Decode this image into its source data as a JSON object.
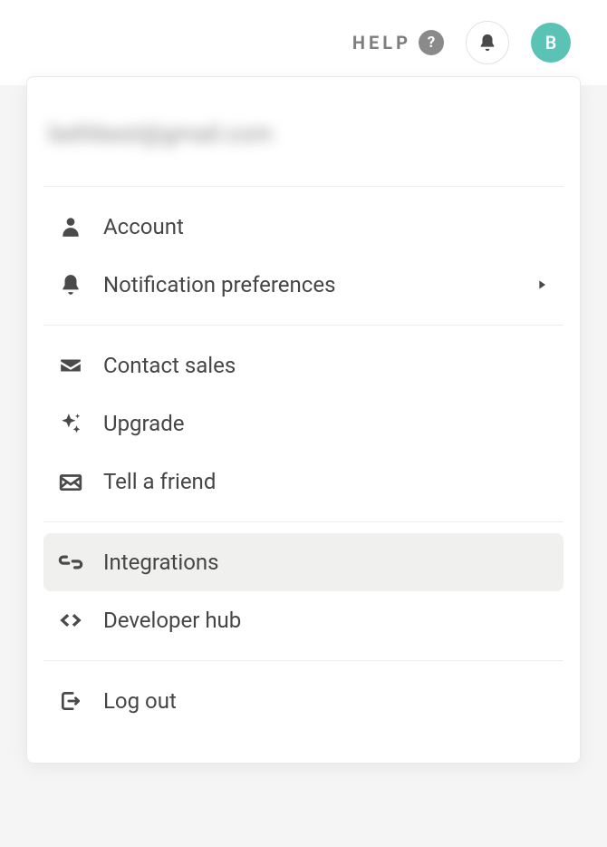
{
  "topbar": {
    "help_label": "HELP",
    "avatar_initial": "B"
  },
  "dropdown": {
    "email": "bethbest@gmail.com",
    "sections": [
      {
        "items": [
          {
            "label": "Account",
            "icon": "user",
            "has_submenu": false,
            "selected": false
          },
          {
            "label": "Notification preferences",
            "icon": "bell",
            "has_submenu": true,
            "selected": false
          }
        ]
      },
      {
        "items": [
          {
            "label": "Contact sales",
            "icon": "envelope",
            "has_submenu": false,
            "selected": false
          },
          {
            "label": "Upgrade",
            "icon": "sparkle",
            "has_submenu": false,
            "selected": false
          },
          {
            "label": "Tell a friend",
            "icon": "mail-open",
            "has_submenu": false,
            "selected": false
          }
        ]
      },
      {
        "items": [
          {
            "label": "Integrations",
            "icon": "link",
            "has_submenu": false,
            "selected": true
          },
          {
            "label": "Developer hub",
            "icon": "code",
            "has_submenu": false,
            "selected": false
          }
        ]
      },
      {
        "items": [
          {
            "label": "Log out",
            "icon": "logout",
            "has_submenu": false,
            "selected": false
          }
        ]
      }
    ]
  },
  "colors": {
    "accent": "#5ac3b6",
    "icon": "#4a4a4a",
    "text": "#454545"
  }
}
